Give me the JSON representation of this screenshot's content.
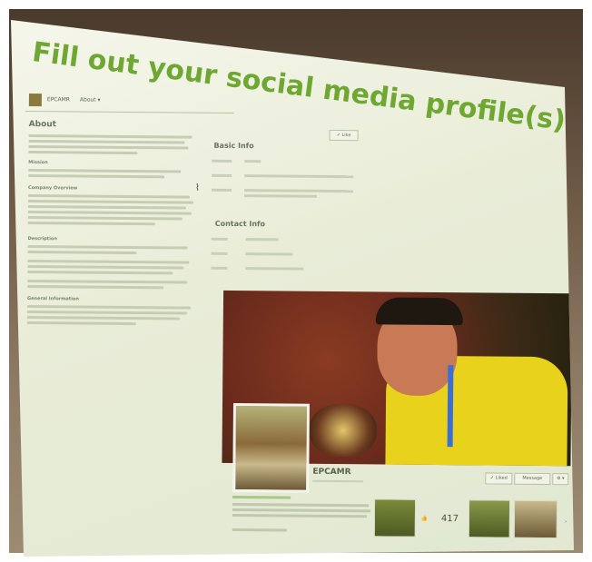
{
  "slide": {
    "title": "Fill out your social media profile(s) completely"
  },
  "facebook": {
    "top_bar": {
      "page_name": "EPCAMR",
      "tab_label": "About ▾"
    },
    "about": {
      "heading": "About",
      "subheadings": [
        "Mission",
        "Company Overview",
        "Description",
        "General Information"
      ]
    },
    "basic_info": {
      "heading": "Basic Info"
    },
    "contact_info": {
      "heading": "Contact Info"
    },
    "like_button": "✓ Like",
    "page_header": {
      "name": "EPCAMR",
      "liked_button": "✓ Liked",
      "message_button": "Message",
      "settings_button": "⚙ ▾"
    },
    "likes": {
      "count": "417"
    }
  },
  "colors": {
    "title_green": "#6ea832",
    "slide_background": "#eef1e0",
    "room_background": "#5a4836",
    "cover_shirt_yellow": "#e8d21c"
  },
  "icons": [
    "facebook-page-logo",
    "like-thumb-icon",
    "settings-gear-icon",
    "chevron-right-icon"
  ]
}
